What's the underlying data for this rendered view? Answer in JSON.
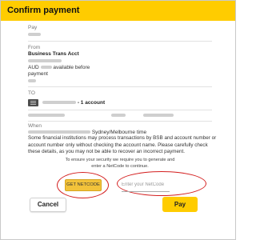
{
  "dialog": {
    "title": "Confirm payment",
    "pay_label": "Pay",
    "from_label": "From",
    "from_account_name": "Business Trans Acct",
    "balance_currency": "AUD",
    "balance_suffix": "available before",
    "balance_suffix2": "payment",
    "to_label": "TO",
    "to_count": "- 1 account",
    "when_label": "When",
    "when_time": "Sydney/Melbourne time",
    "disclaimer": "Some financial institutions may process transactions by BSB and account number or account number only without checking the account name. Please carefully check these details, as you may not be able to recover an incorrect payment.",
    "netcode_note": "To ensure your security we require you to generate and enter a NetCode to continue.",
    "netcode_button": "GET NETCODE",
    "netcode_placeholder": "Enter your NetCode",
    "cancel_button": "Cancel",
    "pay_button": "Pay"
  },
  "colors": {
    "brand_yellow": "#ffcc00",
    "highlight_ring": "#d42020"
  }
}
